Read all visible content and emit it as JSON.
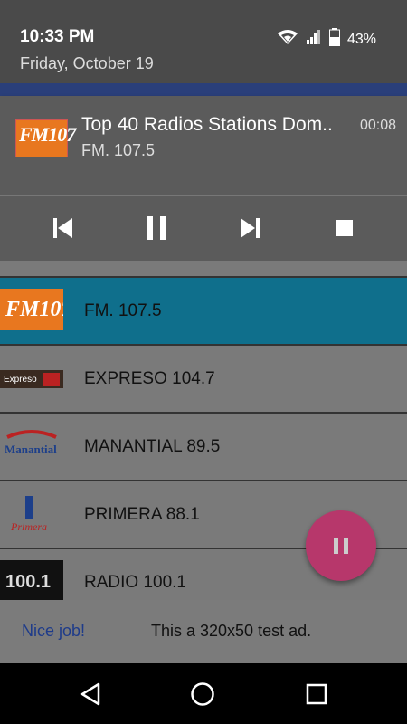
{
  "status_bar": {
    "time": "10:33 PM",
    "date": "Friday, October 19",
    "battery": "43%"
  },
  "media_notification": {
    "logo_text": "FM107",
    "title": "Top 40 Radios Stations Dom..",
    "subtitle": "FM. 107.5",
    "elapsed": "00:08",
    "controls": [
      "skip-previous-icon",
      "pause-icon",
      "skip-next-icon",
      "stop-icon"
    ]
  },
  "stations": [
    {
      "name": "FM. 107.5",
      "logo": "FM107",
      "active": true
    },
    {
      "name": "EXPRESO 104.7",
      "logo": "Expreso",
      "active": false
    },
    {
      "name": "MANANTIAL 89.5",
      "logo": "Manantial",
      "active": false
    },
    {
      "name": "PRIMERA 88.1",
      "logo": "Primera",
      "active": false
    },
    {
      "name": "RADIO 100.1",
      "logo": "100.1",
      "active": false
    }
  ],
  "ad": {
    "nice": "Nice job!",
    "text": "This a 320x50 test ad."
  },
  "colors": {
    "active_row": "#0f6f8c",
    "fab": "#b7376b",
    "fm_orange": "#e8771f"
  }
}
